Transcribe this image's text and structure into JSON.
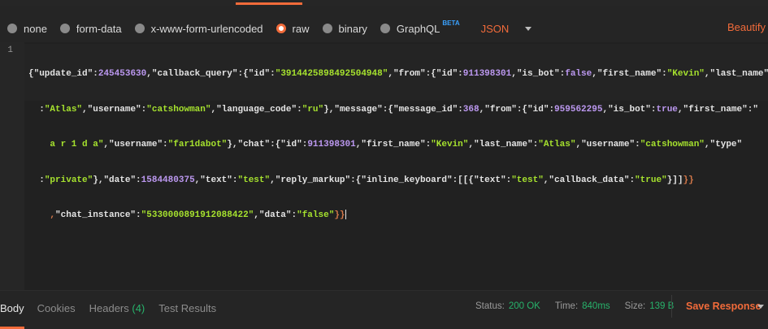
{
  "body_modes": {
    "none": "none",
    "form_data": "form-data",
    "urlencoded": "x-www-form-urlencoded",
    "raw": "raw",
    "binary": "binary",
    "graphql": "GraphQL",
    "graphql_badge": "BETA",
    "selected": "raw"
  },
  "language": "JSON",
  "beautify": "Beautify",
  "editor": {
    "line_number": "1",
    "tokens_line1": [
      [
        "p",
        "{"
      ],
      [
        "k",
        "\"update_id\""
      ],
      [
        "p",
        ":"
      ],
      [
        "n",
        "245453630"
      ],
      [
        "p",
        ","
      ],
      [
        "k",
        "\"callback_query\""
      ],
      [
        "p",
        ":{"
      ],
      [
        "k",
        "\"id\""
      ],
      [
        "p",
        ":"
      ],
      [
        "s",
        "\"3914425898492504948\""
      ],
      [
        "p",
        ","
      ],
      [
        "k",
        "\"from\""
      ],
      [
        "p",
        ":{"
      ],
      [
        "k",
        "\"id\""
      ],
      [
        "p",
        ":"
      ],
      [
        "n",
        "911398301"
      ],
      [
        "p",
        ","
      ],
      [
        "k",
        "\"is_bot\""
      ],
      [
        "p",
        ":"
      ],
      [
        "b",
        "false"
      ],
      [
        "p",
        ","
      ],
      [
        "k",
        "\"first_name\""
      ],
      [
        "p",
        ":"
      ],
      [
        "s",
        "\"Kevin\""
      ],
      [
        "p",
        ","
      ],
      [
        "k",
        "\"last_name\""
      ]
    ],
    "tokens_line2": [
      [
        "p",
        "  :"
      ],
      [
        "s",
        "\"Atlas\""
      ],
      [
        "p",
        ","
      ],
      [
        "k",
        "\"username\""
      ],
      [
        "p",
        ":"
      ],
      [
        "s",
        "\"catshowman\""
      ],
      [
        "p",
        ","
      ],
      [
        "k",
        "\"language_code\""
      ],
      [
        "p",
        ":"
      ],
      [
        "s",
        "\"ru\""
      ],
      [
        "p",
        "},"
      ],
      [
        "k",
        "\"message\""
      ],
      [
        "p",
        ":{"
      ],
      [
        "k",
        "\"message_id\""
      ],
      [
        "p",
        ":"
      ],
      [
        "n",
        "368"
      ],
      [
        "p",
        ","
      ],
      [
        "k",
        "\"from\""
      ],
      [
        "p",
        ":{"
      ],
      [
        "k",
        "\"id\""
      ],
      [
        "p",
        ":"
      ],
      [
        "n",
        "959562295"
      ],
      [
        "p",
        ","
      ],
      [
        "k",
        "\"is_bot\""
      ],
      [
        "p",
        ":"
      ],
      [
        "b",
        "true"
      ],
      [
        "p",
        ","
      ],
      [
        "k",
        "\"first_name\""
      ],
      [
        "p",
        ":\""
      ]
    ],
    "tokens_line3": [
      [
        "s",
        "    a r 1 d a\""
      ],
      [
        "p",
        ","
      ],
      [
        "k",
        "\"username\""
      ],
      [
        "p",
        ":"
      ],
      [
        "s",
        "\"far1dabot\""
      ],
      [
        "p",
        "},"
      ],
      [
        "k",
        "\"chat\""
      ],
      [
        "p",
        ":{"
      ],
      [
        "k",
        "\"id\""
      ],
      [
        "p",
        ":"
      ],
      [
        "n",
        "911398301"
      ],
      [
        "p",
        ","
      ],
      [
        "k",
        "\"first_name\""
      ],
      [
        "p",
        ":"
      ],
      [
        "s",
        "\"Kevin\""
      ],
      [
        "p",
        ","
      ],
      [
        "k",
        "\"last_name\""
      ],
      [
        "p",
        ":"
      ],
      [
        "s",
        "\"Atlas\""
      ],
      [
        "p",
        ","
      ],
      [
        "k",
        "\"username\""
      ],
      [
        "p",
        ":"
      ],
      [
        "s",
        "\"catshowman\""
      ],
      [
        "p",
        ","
      ],
      [
        "k",
        "\"type\""
      ]
    ],
    "tokens_line4": [
      [
        "p",
        "  :"
      ],
      [
        "s",
        "\"private\""
      ],
      [
        "p",
        "},"
      ],
      [
        "k",
        "\"date\""
      ],
      [
        "p",
        ":"
      ],
      [
        "n",
        "1584480375"
      ],
      [
        "p",
        ","
      ],
      [
        "k",
        "\"text\""
      ],
      [
        "p",
        ":"
      ],
      [
        "s",
        "\"test\""
      ],
      [
        "p",
        ","
      ],
      [
        "k",
        "\"reply_markup\""
      ],
      [
        "p",
        ":{"
      ],
      [
        "k",
        "\"inline_keyboard\""
      ],
      [
        "p",
        ":[[{"
      ],
      [
        "k",
        "\"text\""
      ],
      [
        "p",
        ":"
      ],
      [
        "s",
        "\"test\""
      ],
      [
        "p",
        ","
      ],
      [
        "k",
        "\"callback_data\""
      ],
      [
        "p",
        ":"
      ],
      [
        "s",
        "\"true\""
      ],
      [
        "p",
        "}]]"
      ],
      [
        "bracket",
        "}}"
      ]
    ],
    "tokens_line5": [
      [
        "bracket",
        "    ,"
      ],
      [
        "k",
        "\"chat_instance\""
      ],
      [
        "p",
        ":"
      ],
      [
        "s",
        "\"5330000891912088422\""
      ],
      [
        "p",
        ","
      ],
      [
        "k",
        "\"data\""
      ],
      [
        "p",
        ":"
      ],
      [
        "s",
        "\"false\""
      ],
      [
        "bracket",
        "}}"
      ]
    ]
  },
  "response": {
    "tabs": {
      "body": "Body",
      "cookies": "Cookies",
      "headers": "Headers",
      "headers_count": "(4)",
      "test_results": "Test Results"
    },
    "status_label": "Status:",
    "status_value": "200 OK",
    "time_label": "Time:",
    "time_value": "840ms",
    "size_label": "Size:",
    "size_value": "139 B",
    "save": "Save Response"
  },
  "colors": {
    "accent": "#f26b3a",
    "success": "#27b36b",
    "beta": "#3aa2ff"
  }
}
